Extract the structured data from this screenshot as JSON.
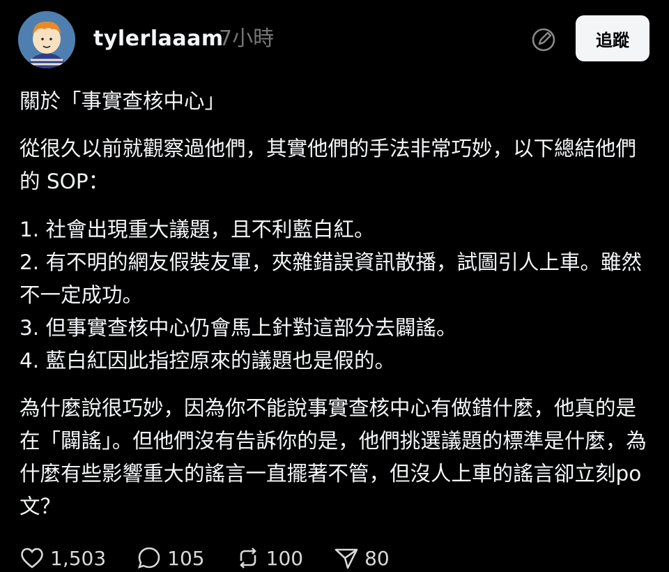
{
  "post": {
    "author": "tylerlaaam",
    "time": "7小時",
    "follow_label": "追蹤",
    "paragraphs": {
      "p1": "關於「事實查核中心」",
      "p2": "從很久以前就觀察過他們，其實他們的手法非常巧妙，以下總結他們的 SOP：",
      "list": [
        "1. 社會出現重大議題，且不利藍白紅。",
        "2. 有不明的網友假裝友軍，夾雜錯誤資訊散播，試圖引人上車。雖然不一定成功。",
        "3. 但事實查核中心仍會馬上針對這部分去闢謠。",
        "4. 藍白紅因此指控原來的議題也是假的。"
      ],
      "p4": "為什麼說很巧妙，因為你不能說事實查核中心有做錯什麼，他真的是在「闢謠」。但他們沒有告訴你的是，他們挑選議題的標準是什麼，為什麼有些影響重大的謠言一直擺著不管，但沒人上車的謠言卻立刻po文？"
    },
    "actions": {
      "likes": "1,503",
      "replies": "105",
      "reposts": "100",
      "shares": "80"
    }
  },
  "icons": {
    "edit": "compose-icon",
    "like": "heart-icon",
    "reply": "comment-icon",
    "repost": "repost-icon",
    "share": "send-icon"
  },
  "colors": {
    "background": "#000000",
    "text": "#f3f5f7",
    "muted": "#777777",
    "button_bg": "#f3f5f7"
  }
}
